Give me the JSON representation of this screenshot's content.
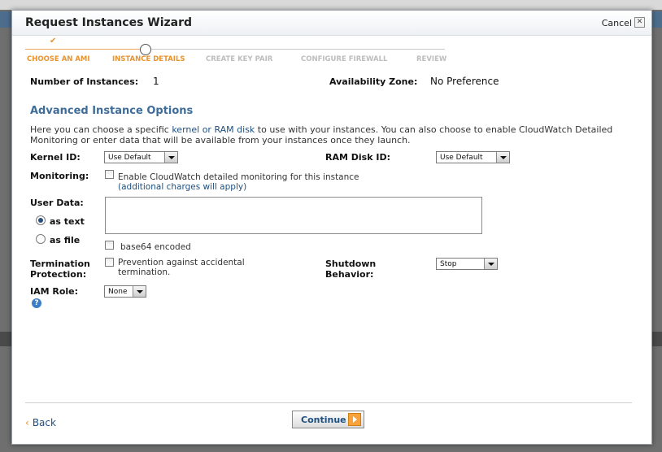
{
  "dialog": {
    "title": "Request Instances Wizard",
    "cancel_label": "Cancel",
    "cancel_icon": "close-icon"
  },
  "steps": [
    {
      "label": "CHOOSE AN AMI",
      "state": "done"
    },
    {
      "label": "INSTANCE DETAILS",
      "state": "active"
    },
    {
      "label": "CREATE KEY PAIR",
      "state": "todo"
    },
    {
      "label": "CONFIGURE FIREWALL",
      "state": "todo"
    },
    {
      "label": "REVIEW",
      "state": "todo"
    }
  ],
  "summary": {
    "instances_label": "Number of Instances:",
    "instances_value": "1",
    "zone_label": "Availability Zone:",
    "zone_value": "No Preference"
  },
  "advanced": {
    "title": "Advanced Instance Options",
    "desc_pre": "Here you can choose a specific ",
    "desc_link": "kernel or RAM disk",
    "desc_post": " to use with your instances. You can also choose to enable CloudWatch Detailed Monitoring or enter data that will be available from your instances once they launch."
  },
  "fields": {
    "kernel_label": "Kernel ID:",
    "kernel_value": "Use Default",
    "ramdisk_label": "RAM Disk ID:",
    "ramdisk_value": "Use Default",
    "monitoring_label": "Monitoring:",
    "monitoring_text": "Enable CloudWatch detailed monitoring for this instance",
    "monitoring_link": "(additional charges will apply)",
    "userdata_label": "User Data:",
    "as_text_label": "as text",
    "as_file_label": "as file",
    "base64_label": "base64 encoded",
    "termination_label_1": "Termination",
    "termination_label_2": "Protection:",
    "termination_text_1": "Prevention against accidental",
    "termination_text_2": "termination.",
    "shutdown_label_1": "Shutdown",
    "shutdown_label_2": "Behavior:",
    "shutdown_value": "Stop",
    "iam_label": "IAM Role:",
    "iam_value": "None"
  },
  "footer": {
    "back_label": "Back",
    "continue_label": "Continue"
  },
  "colors": {
    "accent": "#e8932f",
    "link": "#1d4f80",
    "section_title": "#3f6d99"
  }
}
